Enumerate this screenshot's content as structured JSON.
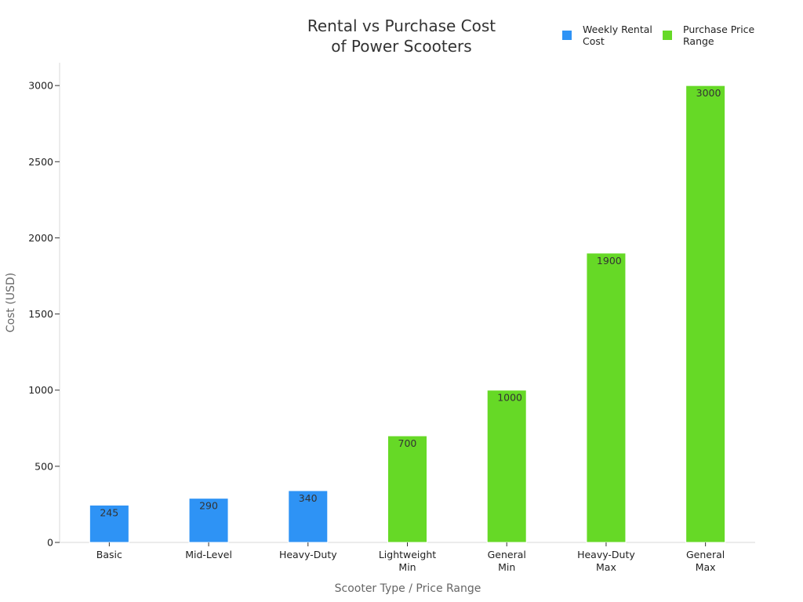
{
  "chart_data": {
    "type": "bar",
    "title_lines": [
      "Rental vs Purchase Cost",
      "of Power Scooters"
    ],
    "xlabel": "Scooter Type / Price Range",
    "ylabel": "Cost (USD)",
    "ylim": [
      0,
      3150
    ],
    "yticks": [
      0,
      500,
      1000,
      1500,
      2000,
      2500,
      3000
    ],
    "grid": false,
    "legend_position": "top-right",
    "categories": [
      [
        "Basic"
      ],
      [
        "Mid-Level"
      ],
      [
        "Heavy-Duty"
      ],
      [
        "Lightweight",
        "Min"
      ],
      [
        "General",
        "Min"
      ],
      [
        "Heavy-Duty",
        "Max"
      ],
      [
        "General",
        "Max"
      ]
    ],
    "series": [
      {
        "name": "Weekly Rental Cost",
        "legend_lines": [
          "Weekly Rental",
          "Cost"
        ],
        "color": "#2e93f5",
        "values": [
          245,
          290,
          340,
          null,
          null,
          null,
          null
        ]
      },
      {
        "name": "Purchase Price Range",
        "legend_lines": [
          "Purchase Price",
          "Range"
        ],
        "color": "#66d926",
        "values": [
          null,
          null,
          null,
          700,
          1000,
          1900,
          3000
        ]
      }
    ]
  }
}
